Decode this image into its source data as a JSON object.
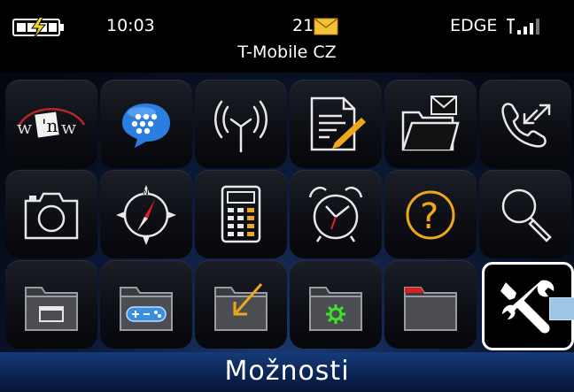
{
  "status_bar": {
    "time": "10:03",
    "message_count": "21",
    "network_type": "EDGE",
    "carrier": "T-Mobile CZ",
    "icons": [
      "battery-charging-icon",
      "envelope-icon",
      "signal-strength-icon"
    ],
    "colors": {
      "battery_bolt": "#f5d320",
      "envelope": "#f2c23c"
    }
  },
  "app_grid": {
    "rows": [
      [
        "wnw-app-icon",
        "blackberry-messenger-icon",
        "antenna-icon",
        "notepad-icon",
        "messages-folder-icon",
        "phone-call-log-icon"
      ],
      [
        "camera-icon",
        "compass-icon",
        "calculator-icon",
        "alarm-clock-icon",
        "help-icon",
        "search-icon"
      ],
      [
        "applications-folder-icon",
        "games-folder-icon",
        "downloads-folder-icon",
        "settings-folder-icon",
        "red-tab-folder-icon",
        "options-wrench-icon"
      ]
    ],
    "selected": "options-wrench-icon"
  },
  "selected_label": "Možnosti",
  "colors": {
    "accent": "#f0a818",
    "selection_border": "#ffffff",
    "label_bar": "#0f2c62",
    "help_orange": "#f0a818",
    "game_blue": "#3c8ee0",
    "settings_green": "#3fe02a",
    "folder_red": "#d82020"
  }
}
